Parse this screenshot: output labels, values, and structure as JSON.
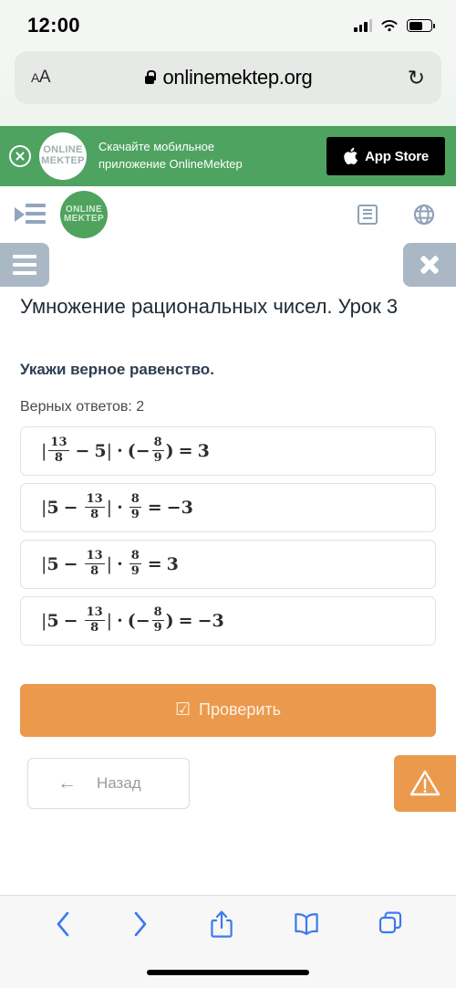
{
  "statusbar": {
    "time": "12:00",
    "signal_icon": "cellular-signal-icon",
    "wifi_icon": "wifi-icon",
    "battery_icon": "battery-icon"
  },
  "browser": {
    "text_size_label": "AA",
    "lock_icon": "lock-icon",
    "url": "onlinemektep.org",
    "reload_glyph": "↻",
    "toolbar": {
      "back_glyph": "‹",
      "forward_glyph": "›",
      "share_icon": "share-icon",
      "bookmarks_icon": "book-icon",
      "tabs_icon": "tabs-icon"
    }
  },
  "app_banner": {
    "close_icon": "close-circle-icon",
    "logo_line1": "ONLINE",
    "logo_line2": "MEKTEP",
    "text_line1": "Скачайте мобильное",
    "text_line2": "приложение OnlineMektep",
    "store_glyph": "",
    "store_label": "App Store",
    "bg_color": "#4fa361"
  },
  "site_header": {
    "menu_toggle_icon": "indent-menu-icon",
    "logo_line1": "ONLINE",
    "logo_line2": "MEKTEP",
    "list_icon": "list-icon",
    "language_icon": "globe-icon",
    "language_glyph": "⊕",
    "brand_color": "#4fa35d"
  },
  "tab_row": {
    "sidebar_toggle_icon": "hamburger-icon",
    "close_icon": "close-icon",
    "bg_color": "#aab8c6"
  },
  "lesson": {
    "title": "Умножение рациональных чисел. Урок 3",
    "prompt": "Укажи верное равенство.",
    "answers_count": "Верных ответов: 2"
  },
  "options": [
    {
      "id": "option-1",
      "latex": "|13/8 − 5| · (−8/9) = 3",
      "parts": {
        "open_abs": "|",
        "left_num": "13",
        "left_den": "8",
        "inner_op": "−",
        "left_term": "5",
        "close_abs": "|",
        "mul": "·",
        "paren_open": "(",
        "sign": "−",
        "right_num": "8",
        "right_den": "9",
        "paren_close": ")",
        "equals": "=",
        "result": "3"
      }
    },
    {
      "id": "option-2",
      "latex": "|5 − 13/8| · 8/9 = −3",
      "parts": {
        "open_abs": "|",
        "left_term": "5",
        "inner_op": "−",
        "left_num": "13",
        "left_den": "8",
        "close_abs": "|",
        "mul": "·",
        "paren_open": "",
        "sign": "",
        "right_num": "8",
        "right_den": "9",
        "paren_close": "",
        "equals": "=",
        "result": "−3"
      }
    },
    {
      "id": "option-3",
      "latex": "|5 − 13/8| · 8/9 = 3",
      "parts": {
        "open_abs": "|",
        "left_term": "5",
        "inner_op": "−",
        "left_num": "13",
        "left_den": "8",
        "close_abs": "|",
        "mul": "·",
        "paren_open": "",
        "sign": "",
        "right_num": "8",
        "right_den": "9",
        "paren_close": "",
        "equals": "=",
        "result": "3"
      }
    },
    {
      "id": "option-4",
      "latex": "|5 − 13/8| · (−8/9) = −3",
      "parts": {
        "open_abs": "|",
        "left_term": "5",
        "inner_op": "−",
        "left_num": "13",
        "left_den": "8",
        "close_abs": "|",
        "mul": "·",
        "paren_open": "(",
        "sign": "−",
        "right_num": "8",
        "right_den": "9",
        "paren_close": ")",
        "equals": "=",
        "result": "−3"
      }
    }
  ],
  "actions": {
    "check_glyph": "☑",
    "check_label": "Проверить",
    "back_glyph": "←",
    "back_label": "Назад",
    "report_icon": "warning-triangle-icon",
    "accent_color": "#eb9a4d"
  }
}
